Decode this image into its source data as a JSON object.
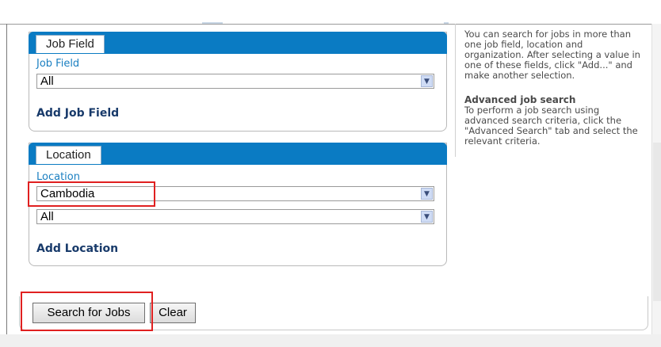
{
  "job_field_panel": {
    "tab_label": "Job Field",
    "field_label": "Job Field",
    "select_value": "All",
    "add_link": "Add Job Field"
  },
  "location_panel": {
    "tab_label": "Location",
    "field_label": "Location",
    "select_primary": "Cambodia",
    "select_secondary": "All",
    "add_link": "Add Location"
  },
  "help": {
    "intro": "You can search for jobs in more than one job field, location and organization. After selecting a value in one of these fields, click \"Add...\" and make another selection.",
    "advanced_heading": "Advanced job search",
    "advanced_text": "To perform a job search using advanced search criteria, click the \"Advanced Search\" tab and select the relevant criteria."
  },
  "buttons": {
    "search": "Search for Jobs",
    "clear": "Clear"
  },
  "colors": {
    "panel_header": "#0a7bc3",
    "field_label": "#1a7fc1",
    "link": "#183a6a",
    "highlight": "#e02020"
  }
}
